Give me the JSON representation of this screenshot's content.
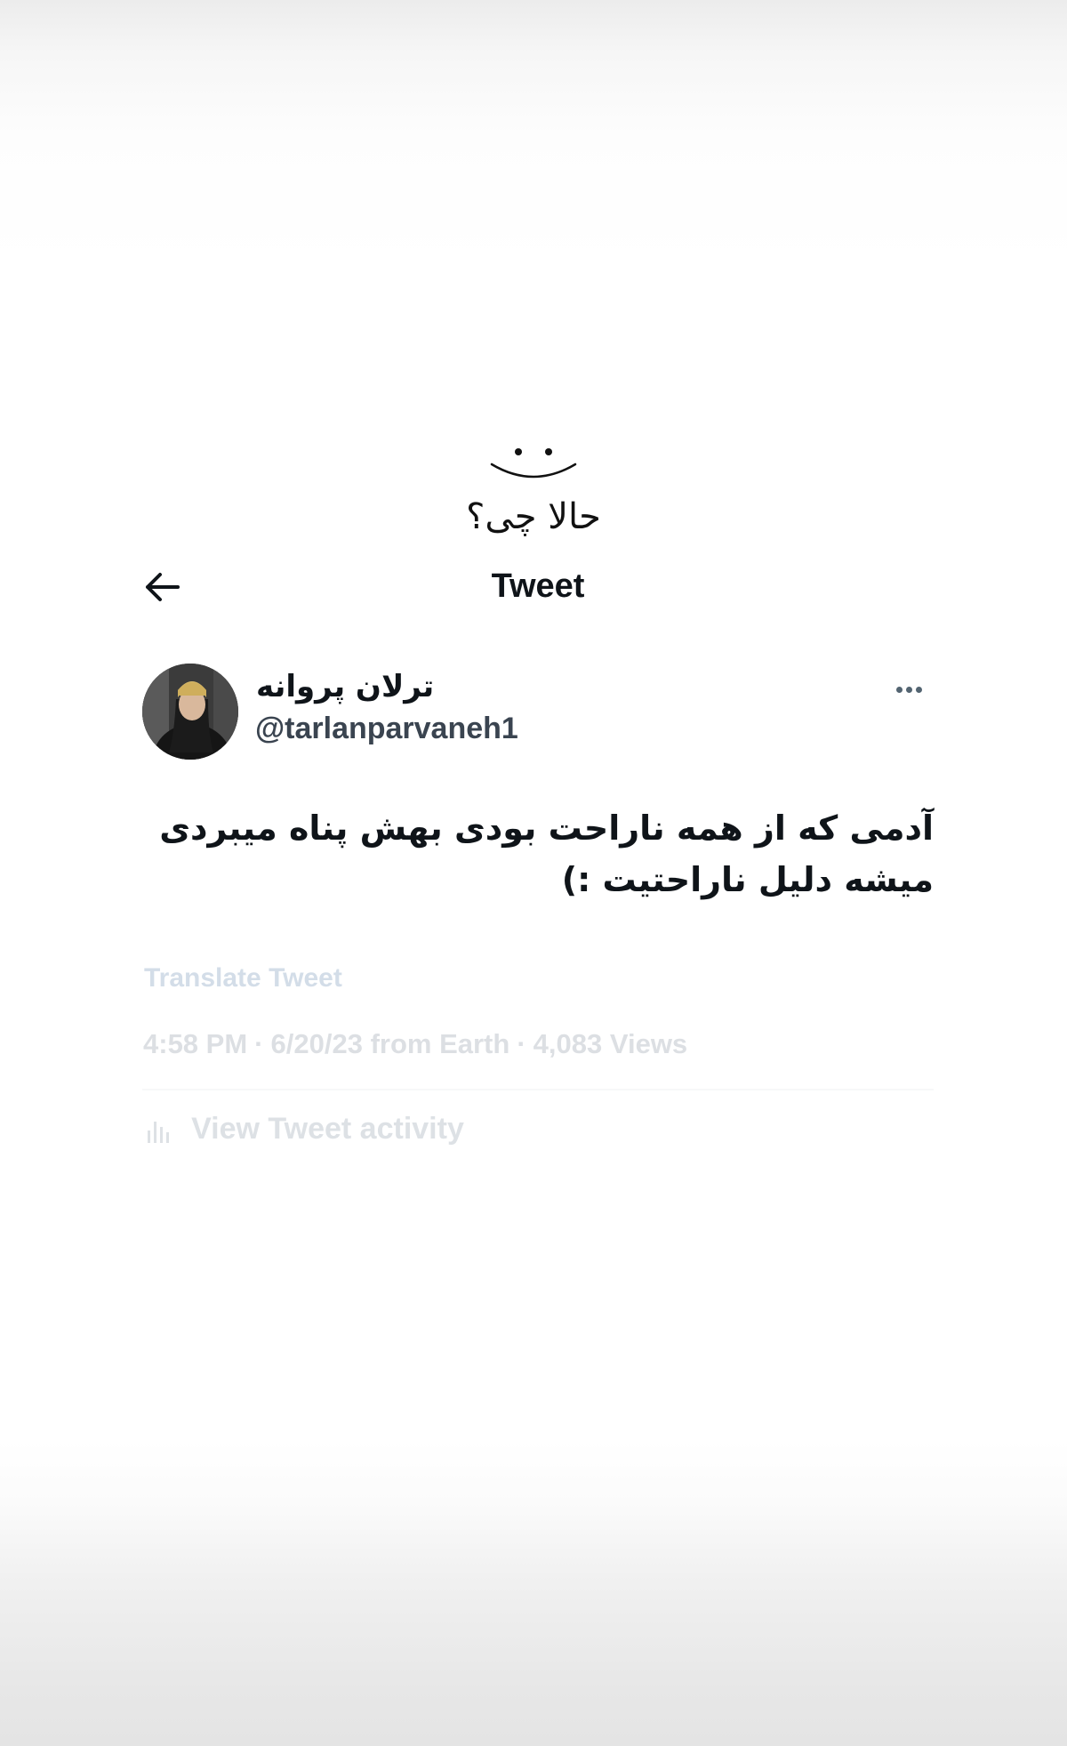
{
  "caption": {
    "text": "حالا چی؟",
    "icon": "smiley-face-icon"
  },
  "header": {
    "back_icon": "back-arrow-icon",
    "title": "Tweet"
  },
  "author": {
    "display_name": "ترلان پروانه",
    "handle": "@tarlanparvaneh1",
    "more_icon": "more-options-icon"
  },
  "tweet": {
    "text_line1": "آدمی که از همه ناراحت بودی بهش پناه میبردی",
    "text_line2": "میشه دلیل ناراحتیت :)"
  },
  "translate_label": "Translate Tweet",
  "meta": {
    "time": "4:58 PM",
    "date": "6/20/23",
    "source": "from Earth",
    "views_count": "4,083",
    "views_label": "Views"
  },
  "activity": {
    "icon": "analytics-icon",
    "label": "View Tweet activity"
  }
}
